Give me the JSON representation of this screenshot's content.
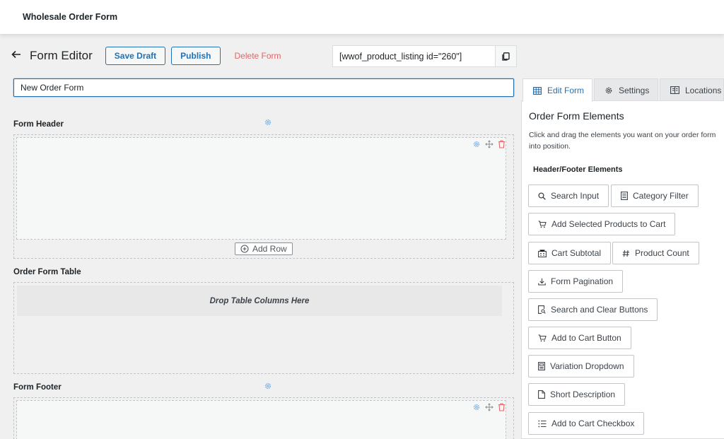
{
  "app_title": "Wholesale Order Form",
  "editor": {
    "title": "Form Editor",
    "save_draft": "Save Draft",
    "publish": "Publish",
    "delete": "Delete Form",
    "shortcode": "[wwof_product_listing id=\"260\"]",
    "form_name_value": "New Order Form"
  },
  "sections": {
    "header": "Form Header",
    "table": "Order Form Table",
    "footer": "Form Footer",
    "add_row": "Add Row",
    "drop_columns": "Drop Table Columns Here"
  },
  "sidebar": {
    "tabs": [
      {
        "label": "Edit Form",
        "icon": "table-icon",
        "active": true
      },
      {
        "label": "Settings",
        "icon": "gear-icon",
        "active": false
      },
      {
        "label": "Locations",
        "icon": "map-icon",
        "active": false
      }
    ],
    "title": "Order Form Elements",
    "description": "Click and drag the elements you want on your order form into position.",
    "subheading": "Header/Footer Elements",
    "elements": [
      {
        "label": "Search Input",
        "icon": "search-icon"
      },
      {
        "label": "Category Filter",
        "icon": "list-icon"
      },
      {
        "label": "Add Selected Products to Cart",
        "icon": "cart-icon"
      },
      {
        "label": "Cart Subtotal",
        "icon": "calculator-icon"
      },
      {
        "label": "Product Count",
        "icon": "hash-icon"
      },
      {
        "label": "Form Pagination",
        "icon": "download-icon"
      },
      {
        "label": "Search and Clear Buttons",
        "icon": "search-doc-icon"
      },
      {
        "label": "Add to Cart Button",
        "icon": "cart-icon"
      },
      {
        "label": "Variation Dropdown",
        "icon": "dropdown-icon"
      },
      {
        "label": "Short Description",
        "icon": "document-icon"
      },
      {
        "label": "Add to Cart Checkbox",
        "icon": "checklist-icon"
      }
    ]
  },
  "colors": {
    "accent": "#2271b1",
    "danger": "#e26565",
    "gear": "#72aee6"
  }
}
